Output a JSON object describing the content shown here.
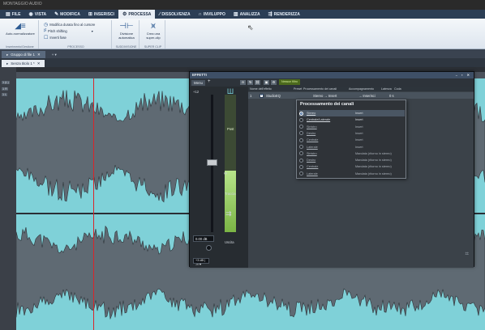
{
  "titlebar": {
    "app_title": "MONTAGGIO AUDIO"
  },
  "menubar": {
    "tabs": [
      {
        "label": "FILE",
        "icon": "file-icon",
        "glyph": "▤"
      },
      {
        "label": "VISTA",
        "icon": "eye-icon",
        "glyph": "◉"
      },
      {
        "label": "MODIFICA",
        "icon": "edit-icon",
        "glyph": "✎"
      },
      {
        "label": "INSERISCI",
        "icon": "insert-icon",
        "glyph": "⊞"
      },
      {
        "label": "PROCESSA",
        "icon": "process-icon",
        "glyph": "⚙"
      },
      {
        "label": "DISSOLVENZA",
        "icon": "fade-icon",
        "glyph": "∕"
      },
      {
        "label": "INVILUPPO",
        "icon": "envelope-icon",
        "glyph": "∩"
      },
      {
        "label": "ANALIZZA",
        "icon": "analyze-icon",
        "glyph": "▥"
      },
      {
        "label": "RENDERIZZA",
        "icon": "render-icon",
        "glyph": "⇶"
      }
    ]
  },
  "ribbon": {
    "volume_button": "Auto-normalizzatore",
    "group1_label": "Inserimento/Gestione",
    "modify_duration": "Modifica durata fino al cursore",
    "pitch_shifting": "Pitch shifting",
    "invert_phase": "Inverti fase",
    "group2_label": "PROCESSO",
    "split_auto": "Divisione automatica",
    "group3_label": "SUDDIVISIONE",
    "create_superclip": "Crea una super-clip",
    "group4_label": "SUPER CLIP"
  },
  "file_tabs": {
    "group": "Gruppo di file 1",
    "add": "+ ▾"
  },
  "doc_tabs": {
    "doc": "Senza titolo 1 *"
  },
  "editor": {
    "track_label_top": "1 (L)",
    "track_label_mid": "1 R",
    "track_label_bottom": "1 L"
  },
  "effects": {
    "title": "EFFETTI",
    "window_controls": "–  ▪  ✕",
    "menu": "Menu",
    "add": "+",
    "fx_button": "Nessun filtro",
    "strip_value": "+12",
    "post_label": "Post",
    "track_label": "Traccia",
    "output_label": "Uscita",
    "gain_value": "0.00 dB",
    "db_dropdown": "+3 dB | -∞ ▾",
    "columns": [
      "Nome dell'effetto",
      "Preset",
      "Processamento dei canali",
      "Accompagnamento",
      "Latenza",
      "Coda"
    ],
    "row": {
      "index": "1",
      "name": "StudioEQ",
      "preset": "",
      "processing": "Stereo → Insert",
      "accomp": "→ Inserisci",
      "latency": "0 s"
    },
    "meter_level": 0.45
  },
  "channel_popup": {
    "title": "Processamento dei canali",
    "options": [
      {
        "name": "Stereo",
        "mode": "Insert",
        "selected": true,
        "dim": false
      },
      {
        "name": "Centrale/Laterale",
        "mode": "Insert",
        "selected": false,
        "dim": false
      },
      {
        "name": "Sinistro",
        "mode": "Insert",
        "selected": false,
        "dim": true
      },
      {
        "name": "Destro",
        "mode": "Insert",
        "selected": false,
        "dim": true
      },
      {
        "name": "Centrale",
        "mode": "Insert",
        "selected": false,
        "dim": true
      },
      {
        "name": "Laterale",
        "mode": "Insert",
        "selected": false,
        "dim": true
      },
      {
        "name": "Sinistro",
        "mode": "Mandata (ritorno in stereo)",
        "selected": false,
        "dim": true
      },
      {
        "name": "Destro",
        "mode": "Mandata (ritorno in stereo)",
        "selected": false,
        "dim": true
      },
      {
        "name": "Centrale",
        "mode": "Mandata (ritorno in stereo)",
        "selected": false,
        "dim": true
      },
      {
        "name": "Laterale",
        "mode": "Mandata (ritorno in stereo)",
        "selected": false,
        "dim": true
      }
    ]
  },
  "colors": {
    "accent": "#2c3e55",
    "waveform": "#7fd1d8",
    "playhead": "#d8262b",
    "meter": "#9acd62"
  }
}
